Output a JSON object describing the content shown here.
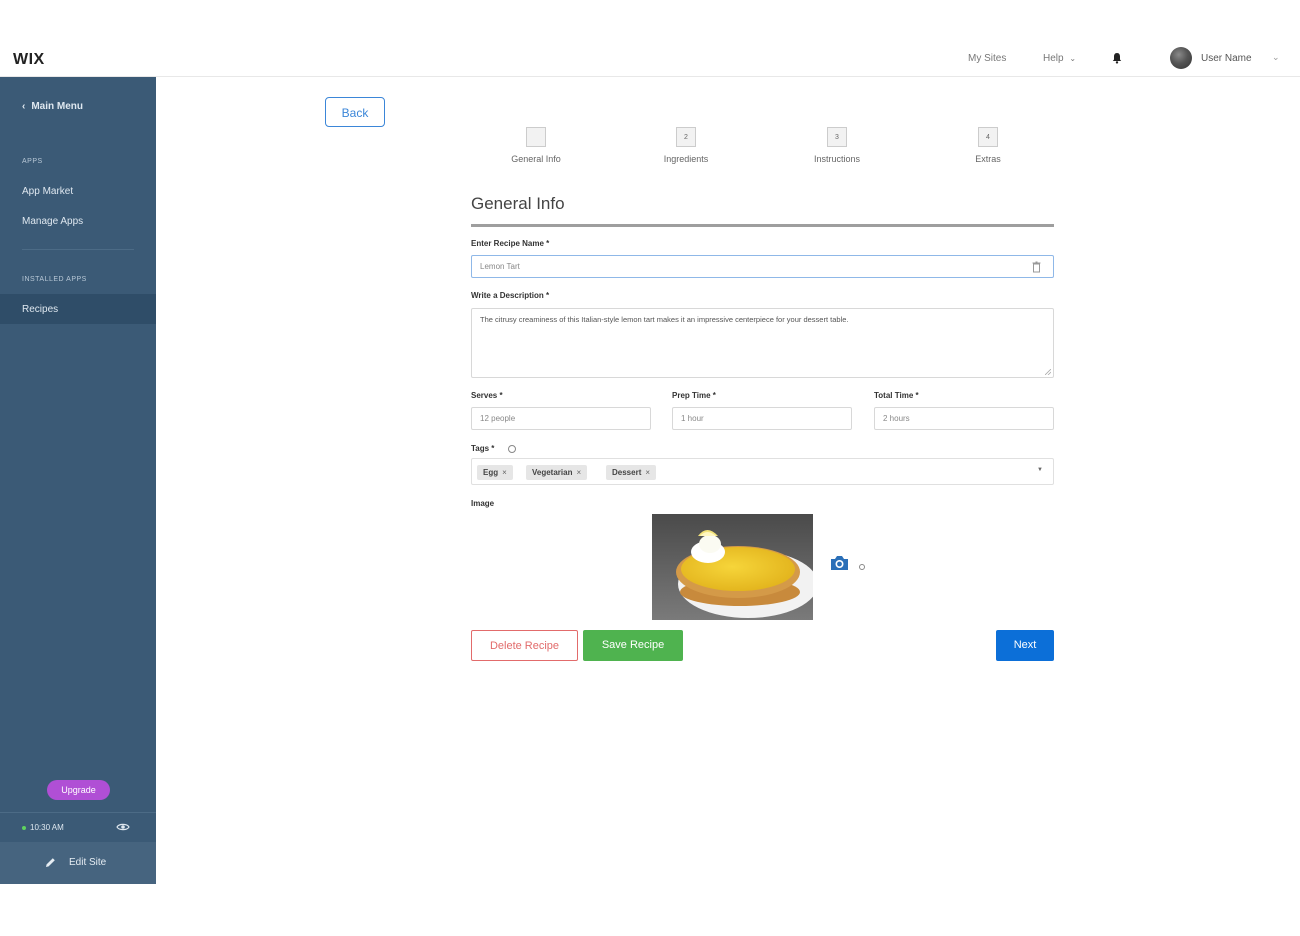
{
  "brand": "WIX",
  "topbar": {
    "my_sites": "My Sites",
    "help": "Help",
    "user_name": "User Name"
  },
  "sidebar": {
    "main_menu": "Main Menu",
    "apps_section": "APPS",
    "items": [
      "App Market",
      "Manage Apps"
    ],
    "installed_section": "INSTALLED APPS",
    "installed_items": [
      "Recipes"
    ],
    "upgrade": "Upgrade",
    "status_time": "10:30 AM",
    "edit_site": "Edit Site"
  },
  "back_label": "Back",
  "steps": [
    {
      "number": "",
      "label": "General Info"
    },
    {
      "number": "2",
      "label": "Ingredients"
    },
    {
      "number": "3",
      "label": "Instructions"
    },
    {
      "number": "4",
      "label": "Extras"
    }
  ],
  "form": {
    "title": "General Info",
    "recipe_name_label": "Enter Recipe Name *",
    "recipe_name_value": "Lemon Tart",
    "description_label": "Write a Description *",
    "description_value": "The citrusy creaminess of this Italian-style lemon tart makes it an impressive centerpiece for your dessert table.",
    "serves_label": "Serves *",
    "serves_value": "12 people",
    "prep_label": "Prep Time *",
    "prep_value": "1 hour",
    "total_label": "Total Time *",
    "total_value": "2 hours",
    "tags_label": "Tags *",
    "tags": [
      "Egg",
      "Vegetarian",
      "Dessert"
    ],
    "image_label": "Image"
  },
  "actions": {
    "delete": "Delete Recipe",
    "save": "Save Recipe",
    "next": "Next"
  },
  "colors": {
    "sidebar_bg": "#3b5a76",
    "primary_blue": "#0c6fd8",
    "save_green": "#4fb34f",
    "delete_red": "#e26b6b",
    "upgrade_purple": "#b04fd5"
  },
  "icons": [
    "chevron-left-icon",
    "chevron-down-icon",
    "bell-icon",
    "eye-icon",
    "pencil-icon",
    "trash-icon",
    "info-icon",
    "camera-icon",
    "tag-remove-icon",
    "caret-down-icon"
  ]
}
